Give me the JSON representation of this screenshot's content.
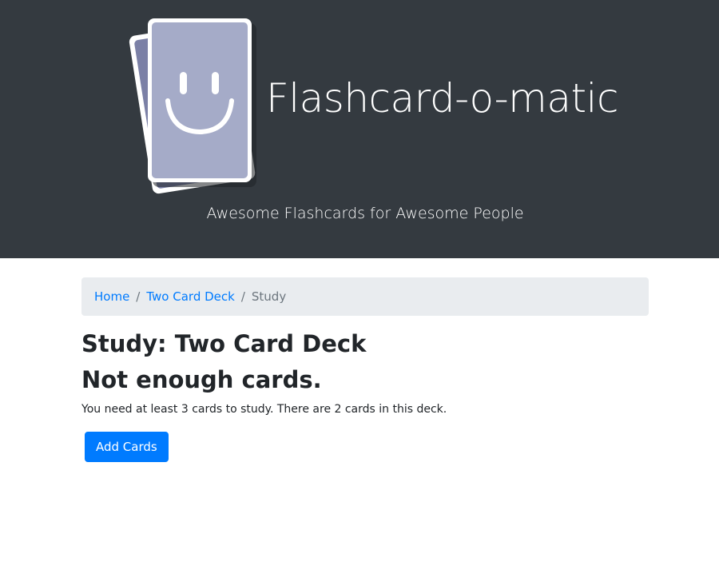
{
  "header": {
    "logo_icon": "smiley-flashcards-logo",
    "title": "Flashcard-o-matic",
    "tagline": "Awesome Flashcards for Awesome People"
  },
  "breadcrumb": {
    "items": [
      {
        "label": "Home",
        "link": true
      },
      {
        "label": "Two Card Deck",
        "link": true
      },
      {
        "label": "Study",
        "link": false
      }
    ],
    "separator": "/"
  },
  "main": {
    "study_title": "Study: Two Card Deck",
    "warning_heading": "Not enough cards.",
    "message": "You need at least 3 cards to study. There are 2 cards in this deck.",
    "add_button_label": "Add Cards"
  },
  "colors": {
    "header_bg": "#343a40",
    "link": "#007bff",
    "primary_button": "#007bff",
    "breadcrumb_bg": "#e9ecef",
    "card_face": "#a5abc8",
    "card_back": "#7b80a6"
  }
}
